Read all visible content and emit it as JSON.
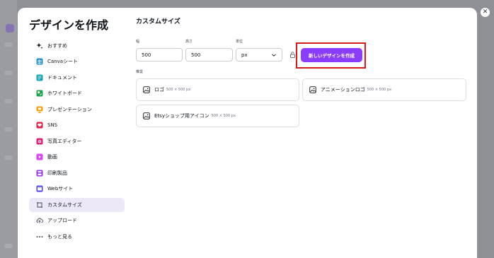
{
  "sidebar": {
    "title": "デザインを作成",
    "items": [
      {
        "label": "おすすめ",
        "icon": "sparkle-icon",
        "color": "#0e1318"
      },
      {
        "label": "Canvaシート",
        "icon": "sheet-icon",
        "color": "#1f8dd6"
      },
      {
        "label": "ドキュメント",
        "icon": "document-icon",
        "color": "#13a3b5"
      },
      {
        "label": "ホワイトボード",
        "icon": "whiteboard-icon",
        "color": "#16a34a"
      },
      {
        "label": "プレゼンテーション",
        "icon": "presentation-icon",
        "color": "#f59e0b"
      },
      {
        "label": "SNS",
        "icon": "heart-icon",
        "color": "#e11d48"
      },
      {
        "label": "写真エディター",
        "icon": "camera-icon",
        "color": "#db2777"
      },
      {
        "label": "動画",
        "icon": "video-icon",
        "color": "#d946ef"
      },
      {
        "label": "印刷製品",
        "icon": "printer-icon",
        "color": "#9333ea"
      },
      {
        "label": "Webサイト",
        "icon": "website-icon",
        "color": "#4f46e5"
      },
      {
        "label": "カスタムサイズ",
        "icon": "custom-size-icon",
        "color": "#3d4450"
      },
      {
        "label": "アップロード",
        "icon": "upload-cloud-icon",
        "color": "#3d4450"
      },
      {
        "label": "もっと見る",
        "icon": "more-dots-icon",
        "color": "#3d4450"
      }
    ],
    "active_index": 10
  },
  "main": {
    "title": "カスタムサイズ",
    "width_label": "幅",
    "width_value": "500",
    "height_label": "高さ",
    "height_value": "500",
    "unit_label": "単位",
    "unit_value": "px",
    "create_button": "新しいデザインを作成",
    "recommended_label": "推奨",
    "presets": [
      {
        "name": "ロゴ",
        "dims": "500 × 500 px"
      },
      {
        "name": "アニメーションロゴ",
        "dims": "500 × 500 px"
      },
      {
        "name": "Etsyショップ用アイコン",
        "dims": "500 × 500 px"
      }
    ]
  },
  "colors": {
    "accent": "#8b3dff",
    "active_bg": "#ede8f7",
    "highlight": "#d91b1b"
  }
}
